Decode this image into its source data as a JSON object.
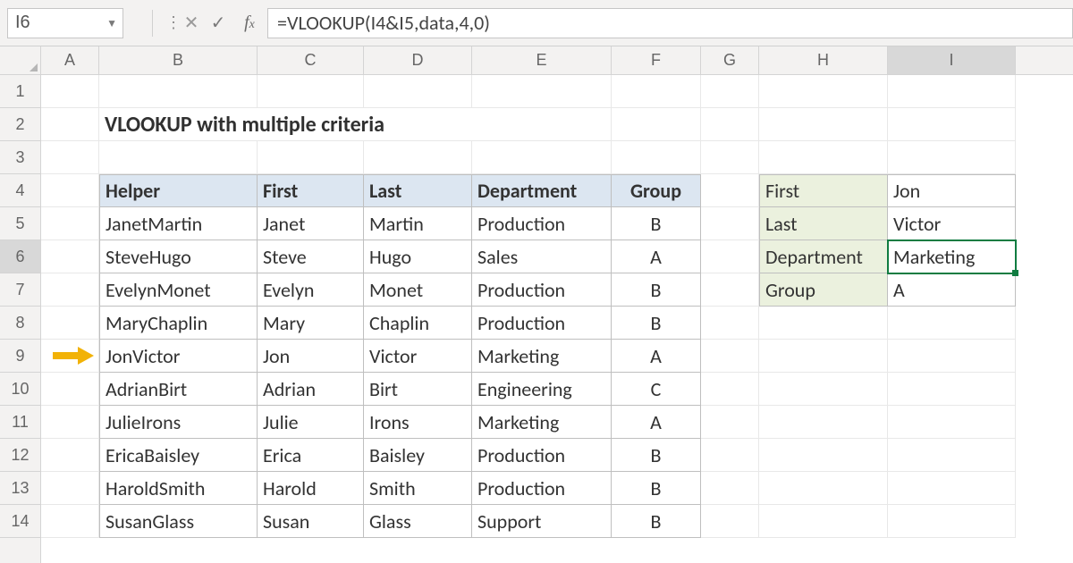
{
  "formula_bar": {
    "cell_ref": "I6",
    "formula": "=VLOOKUP(I4&I5,data,4,0)"
  },
  "columns": [
    "A",
    "B",
    "C",
    "D",
    "E",
    "F",
    "G",
    "H",
    "I"
  ],
  "active_column": "I",
  "row_numbers": [
    1,
    2,
    3,
    4,
    5,
    6,
    7,
    8,
    9,
    10,
    11,
    12,
    13,
    14
  ],
  "active_row": 6,
  "title": "VLOOKUP with multiple criteria",
  "headers": {
    "helper": "Helper",
    "first": "First",
    "last": "Last",
    "dept": "Department",
    "group": "Group"
  },
  "rows": [
    {
      "helper": "JanetMartin",
      "first": "Janet",
      "last": "Martin",
      "dept": "Production",
      "group": "B"
    },
    {
      "helper": "SteveHugo",
      "first": "Steve",
      "last": "Hugo",
      "dept": "Sales",
      "group": "A"
    },
    {
      "helper": "EvelynMonet",
      "first": "Evelyn",
      "last": "Monet",
      "dept": "Production",
      "group": "B"
    },
    {
      "helper": "MaryChaplin",
      "first": "Mary",
      "last": "Chaplin",
      "dept": "Production",
      "group": "B"
    },
    {
      "helper": "JonVictor",
      "first": "Jon",
      "last": "Victor",
      "dept": "Marketing",
      "group": "A"
    },
    {
      "helper": "AdrianBirt",
      "first": "Adrian",
      "last": "Birt",
      "dept": "Engineering",
      "group": "C"
    },
    {
      "helper": "JulieIrons",
      "first": "Julie",
      "last": "Irons",
      "dept": "Marketing",
      "group": "A"
    },
    {
      "helper": "EricaBaisley",
      "first": "Erica",
      "last": "Baisley",
      "dept": "Production",
      "group": "B"
    },
    {
      "helper": "HaroldSmith",
      "first": "Harold",
      "last": "Smith",
      "dept": "Production",
      "group": "B"
    },
    {
      "helper": "SusanGlass",
      "first": "Susan",
      "last": "Glass",
      "dept": "Support",
      "group": "B"
    }
  ],
  "lookup": {
    "labels": {
      "first": "First",
      "last": "Last",
      "dept": "Department",
      "group": "Group"
    },
    "values": {
      "first": "Jon",
      "last": "Victor",
      "dept": "Marketing",
      "group": "A"
    }
  }
}
